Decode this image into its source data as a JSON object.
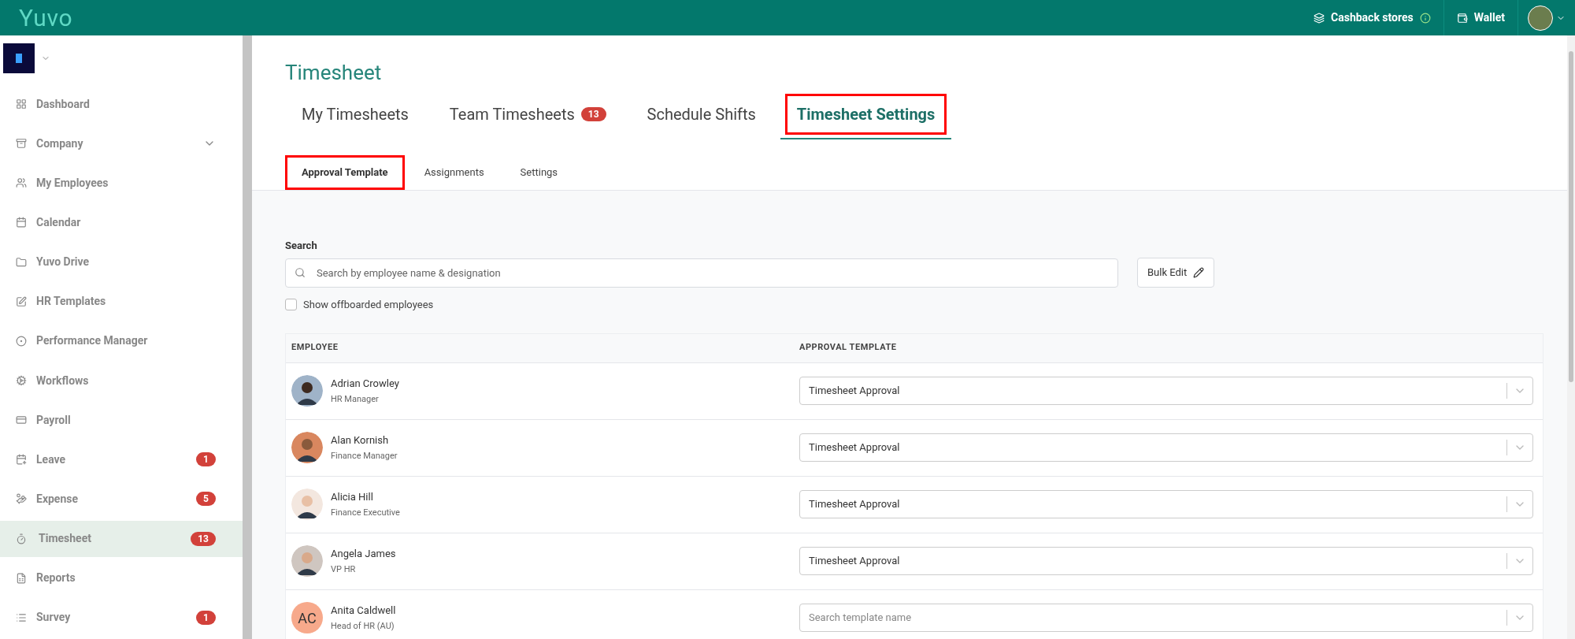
{
  "topbar": {
    "logo": "Yuvo",
    "links": [
      "Cashback stores",
      "Wallet"
    ]
  },
  "sidebar": {
    "items": [
      {
        "label": "Dashboard",
        "selected": false
      },
      {
        "label": "Company",
        "selected": false,
        "expandable": true
      },
      {
        "label": "My Employees",
        "selected": false
      },
      {
        "label": "Calendar",
        "selected": false
      },
      {
        "label": "Yuvo Drive",
        "selected": false
      },
      {
        "label": "HR Templates",
        "selected": false
      },
      {
        "label": "Performance Manager",
        "selected": false
      },
      {
        "label": "Workflows",
        "selected": false
      },
      {
        "label": "Payroll",
        "selected": false
      },
      {
        "label": "Leave",
        "selected": false,
        "badge": "1"
      },
      {
        "label": "Expense",
        "selected": false,
        "badge": "5"
      },
      {
        "label": "Timesheet",
        "selected": true,
        "badge": "13"
      },
      {
        "label": "Reports",
        "selected": false
      },
      {
        "label": "Survey",
        "selected": false,
        "badge": "1"
      }
    ]
  },
  "page": {
    "title": "Timesheet"
  },
  "tabs": [
    {
      "label": "My Timesheets",
      "selected": false,
      "highlighted": false
    },
    {
      "label": "Team Timesheets",
      "selected": false,
      "highlighted": false,
      "badge": "13"
    },
    {
      "label": "Schedule Shifts",
      "selected": false,
      "highlighted": false
    },
    {
      "label": "Timesheet Settings",
      "selected": true,
      "highlighted": true
    }
  ],
  "subtabs": [
    {
      "label": "Approval Template",
      "selected": true,
      "highlighted": true
    },
    {
      "label": "Assignments",
      "selected": false,
      "highlighted": false
    },
    {
      "label": "Settings",
      "selected": false,
      "highlighted": false
    }
  ],
  "search": {
    "label": "Search",
    "placeholder": "Search by employee name & designation"
  },
  "bulk_edit": "Bulk Edit",
  "show_offboarded": {
    "label": "Show offboarded employees",
    "checked": false
  },
  "table": {
    "columns": [
      "EMPLOYEE",
      "APPROVAL TEMPLATE"
    ],
    "rows": [
      {
        "name": "Adrian Crowley",
        "role": "HR Manager",
        "template": {
          "value": "Timesheet Approval"
        }
      },
      {
        "name": "Alan Kornish",
        "role": "Finance Manager",
        "template": {
          "value": "Timesheet Approval"
        }
      },
      {
        "name": "Alicia Hill",
        "role": "Finance Executive",
        "template": {
          "value": "Timesheet Approval"
        }
      },
      {
        "name": "Angela James",
        "role": "VP HR",
        "template": {
          "value": "Timesheet Approval"
        }
      },
      {
        "name": "Anita Caldwell",
        "role": "Head of HR (AU)",
        "avatar": {
          "kind": "initials",
          "text": "AC"
        },
        "template": {
          "placeholder": "Search template name"
        }
      }
    ]
  }
}
